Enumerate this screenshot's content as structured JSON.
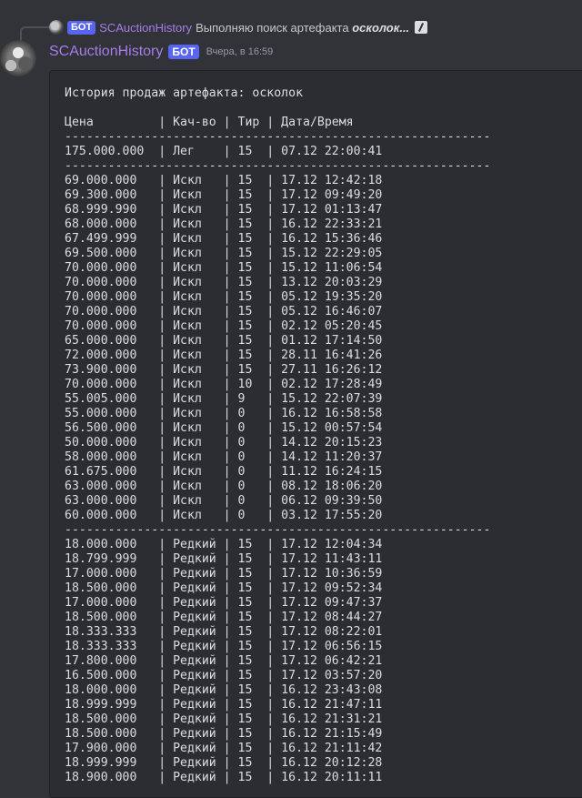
{
  "reply": {
    "bot_tag": "БОТ",
    "username": "SCAuctionHistory",
    "text_prefix": "Выполняю поиск артефакта ",
    "text_em": "осколок...",
    "attachment_icon": "slash-attachment-icon"
  },
  "message": {
    "username": "SCAuctionHistory",
    "bot_tag": "БОТ",
    "timestamp": "Вчера, в 16:59",
    "lines": [
      "История продаж артефакта: осколок",
      "",
      "Цена         | Кач-во | Тир | Дата/Время",
      "-----------------------------------------------------------",
      "175.000.000  | Лег    | 15  | 07.12 22:00:41",
      "-----------------------------------------------------------",
      "69.000.000   | Искл   | 15  | 17.12 12:42:18",
      "69.300.000   | Искл   | 15  | 17.12 09:49:20",
      "68.999.990   | Искл   | 15  | 17.12 01:13:47",
      "68.000.000   | Искл   | 15  | 16.12 22:33:21",
      "67.499.999   | Искл   | 15  | 16.12 15:36:46",
      "69.500.000   | Искл   | 15  | 15.12 22:29:05",
      "70.000.000   | Искл   | 15  | 15.12 11:06:54",
      "70.000.000   | Искл   | 15  | 13.12 20:03:29",
      "70.000.000   | Искл   | 15  | 05.12 19:35:20",
      "70.000.000   | Искл   | 15  | 05.12 16:46:07",
      "70.000.000   | Искл   | 15  | 02.12 05:20:45",
      "65.000.000   | Искл   | 15  | 01.12 17:14:50",
      "72.000.000   | Искл   | 15  | 28.11 16:41:26",
      "73.900.000   | Искл   | 15  | 27.11 16:26:12",
      "70.000.000   | Искл   | 10  | 02.12 17:28:49",
      "55.005.000   | Искл   | 9   | 15.12 22:07:39",
      "55.000.000   | Искл   | 0   | 16.12 16:58:58",
      "56.500.000   | Искл   | 0   | 15.12 00:57:54",
      "50.000.000   | Искл   | 0   | 14.12 20:15:23",
      "58.000.000   | Искл   | 0   | 14.12 11:20:37",
      "61.675.000   | Искл   | 0   | 11.12 16:24:15",
      "63.000.000   | Искл   | 0   | 08.12 18:06:20",
      "63.000.000   | Искл   | 0   | 06.12 09:39:50",
      "60.000.000   | Искл   | 0   | 03.12 17:55:20",
      "-----------------------------------------------------------",
      "18.000.000   | Редкий | 15  | 17.12 12:04:34",
      "18.799.999   | Редкий | 15  | 17.12 11:43:11",
      "17.000.000   | Редкий | 15  | 17.12 10:36:59",
      "18.500.000   | Редкий | 15  | 17.12 09:52:34",
      "17.000.000   | Редкий | 15  | 17.12 09:47:37",
      "18.500.000   | Редкий | 15  | 17.12 08:44:27",
      "18.333.333   | Редкий | 15  | 17.12 08:22:01",
      "18.333.333   | Редкий | 15  | 17.12 06:56:15",
      "17.800.000   | Редкий | 15  | 17.12 06:42:21",
      "16.500.000   | Редкий | 15  | 17.12 03:57:20",
      "18.000.000   | Редкий | 15  | 16.12 23:43:08",
      "18.999.999   | Редкий | 15  | 16.12 21:47:11",
      "18.500.000   | Редкий | 15  | 16.12 21:31:21",
      "18.500.000   | Редкий | 15  | 16.12 21:15:49",
      "17.900.000   | Редкий | 15  | 16.12 21:11:42",
      "18.999.999   | Редкий | 15  | 16.12 20:12:28",
      "18.900.000   | Редкий | 15  | 16.12 20:11:11"
    ]
  },
  "colors": {
    "background": "#313338",
    "codeblock": "#2b2d31",
    "username": "#a67ce8",
    "bot_tag": "#5865f2",
    "text": "#dbdee1",
    "muted": "#949ba4"
  }
}
